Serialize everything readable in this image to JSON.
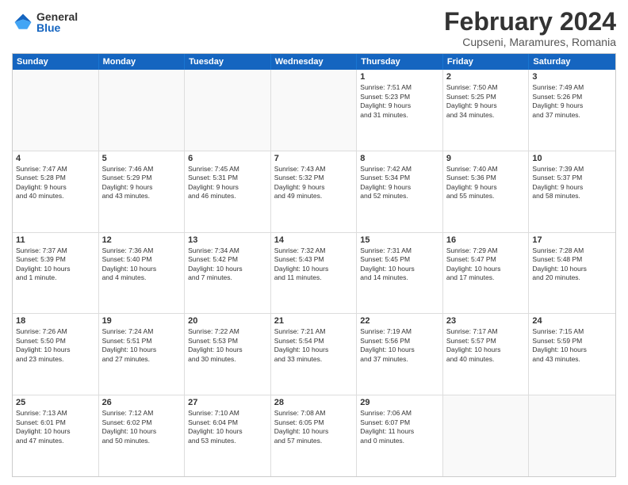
{
  "logo": {
    "general": "General",
    "blue": "Blue"
  },
  "title": "February 2024",
  "subtitle": "Cupseni, Maramures, Romania",
  "days_of_week": [
    "Sunday",
    "Monday",
    "Tuesday",
    "Wednesday",
    "Thursday",
    "Friday",
    "Saturday"
  ],
  "weeks": [
    [
      {
        "day": "",
        "text": ""
      },
      {
        "day": "",
        "text": ""
      },
      {
        "day": "",
        "text": ""
      },
      {
        "day": "",
        "text": ""
      },
      {
        "day": "1",
        "text": "Sunrise: 7:51 AM\nSunset: 5:23 PM\nDaylight: 9 hours\nand 31 minutes."
      },
      {
        "day": "2",
        "text": "Sunrise: 7:50 AM\nSunset: 5:25 PM\nDaylight: 9 hours\nand 34 minutes."
      },
      {
        "day": "3",
        "text": "Sunrise: 7:49 AM\nSunset: 5:26 PM\nDaylight: 9 hours\nand 37 minutes."
      }
    ],
    [
      {
        "day": "4",
        "text": "Sunrise: 7:47 AM\nSunset: 5:28 PM\nDaylight: 9 hours\nand 40 minutes."
      },
      {
        "day": "5",
        "text": "Sunrise: 7:46 AM\nSunset: 5:29 PM\nDaylight: 9 hours\nand 43 minutes."
      },
      {
        "day": "6",
        "text": "Sunrise: 7:45 AM\nSunset: 5:31 PM\nDaylight: 9 hours\nand 46 minutes."
      },
      {
        "day": "7",
        "text": "Sunrise: 7:43 AM\nSunset: 5:32 PM\nDaylight: 9 hours\nand 49 minutes."
      },
      {
        "day": "8",
        "text": "Sunrise: 7:42 AM\nSunset: 5:34 PM\nDaylight: 9 hours\nand 52 minutes."
      },
      {
        "day": "9",
        "text": "Sunrise: 7:40 AM\nSunset: 5:36 PM\nDaylight: 9 hours\nand 55 minutes."
      },
      {
        "day": "10",
        "text": "Sunrise: 7:39 AM\nSunset: 5:37 PM\nDaylight: 9 hours\nand 58 minutes."
      }
    ],
    [
      {
        "day": "11",
        "text": "Sunrise: 7:37 AM\nSunset: 5:39 PM\nDaylight: 10 hours\nand 1 minute."
      },
      {
        "day": "12",
        "text": "Sunrise: 7:36 AM\nSunset: 5:40 PM\nDaylight: 10 hours\nand 4 minutes."
      },
      {
        "day": "13",
        "text": "Sunrise: 7:34 AM\nSunset: 5:42 PM\nDaylight: 10 hours\nand 7 minutes."
      },
      {
        "day": "14",
        "text": "Sunrise: 7:32 AM\nSunset: 5:43 PM\nDaylight: 10 hours\nand 11 minutes."
      },
      {
        "day": "15",
        "text": "Sunrise: 7:31 AM\nSunset: 5:45 PM\nDaylight: 10 hours\nand 14 minutes."
      },
      {
        "day": "16",
        "text": "Sunrise: 7:29 AM\nSunset: 5:47 PM\nDaylight: 10 hours\nand 17 minutes."
      },
      {
        "day": "17",
        "text": "Sunrise: 7:28 AM\nSunset: 5:48 PM\nDaylight: 10 hours\nand 20 minutes."
      }
    ],
    [
      {
        "day": "18",
        "text": "Sunrise: 7:26 AM\nSunset: 5:50 PM\nDaylight: 10 hours\nand 23 minutes."
      },
      {
        "day": "19",
        "text": "Sunrise: 7:24 AM\nSunset: 5:51 PM\nDaylight: 10 hours\nand 27 minutes."
      },
      {
        "day": "20",
        "text": "Sunrise: 7:22 AM\nSunset: 5:53 PM\nDaylight: 10 hours\nand 30 minutes."
      },
      {
        "day": "21",
        "text": "Sunrise: 7:21 AM\nSunset: 5:54 PM\nDaylight: 10 hours\nand 33 minutes."
      },
      {
        "day": "22",
        "text": "Sunrise: 7:19 AM\nSunset: 5:56 PM\nDaylight: 10 hours\nand 37 minutes."
      },
      {
        "day": "23",
        "text": "Sunrise: 7:17 AM\nSunset: 5:57 PM\nDaylight: 10 hours\nand 40 minutes."
      },
      {
        "day": "24",
        "text": "Sunrise: 7:15 AM\nSunset: 5:59 PM\nDaylight: 10 hours\nand 43 minutes."
      }
    ],
    [
      {
        "day": "25",
        "text": "Sunrise: 7:13 AM\nSunset: 6:01 PM\nDaylight: 10 hours\nand 47 minutes."
      },
      {
        "day": "26",
        "text": "Sunrise: 7:12 AM\nSunset: 6:02 PM\nDaylight: 10 hours\nand 50 minutes."
      },
      {
        "day": "27",
        "text": "Sunrise: 7:10 AM\nSunset: 6:04 PM\nDaylight: 10 hours\nand 53 minutes."
      },
      {
        "day": "28",
        "text": "Sunrise: 7:08 AM\nSunset: 6:05 PM\nDaylight: 10 hours\nand 57 minutes."
      },
      {
        "day": "29",
        "text": "Sunrise: 7:06 AM\nSunset: 6:07 PM\nDaylight: 11 hours\nand 0 minutes."
      },
      {
        "day": "",
        "text": ""
      },
      {
        "day": "",
        "text": ""
      }
    ]
  ]
}
